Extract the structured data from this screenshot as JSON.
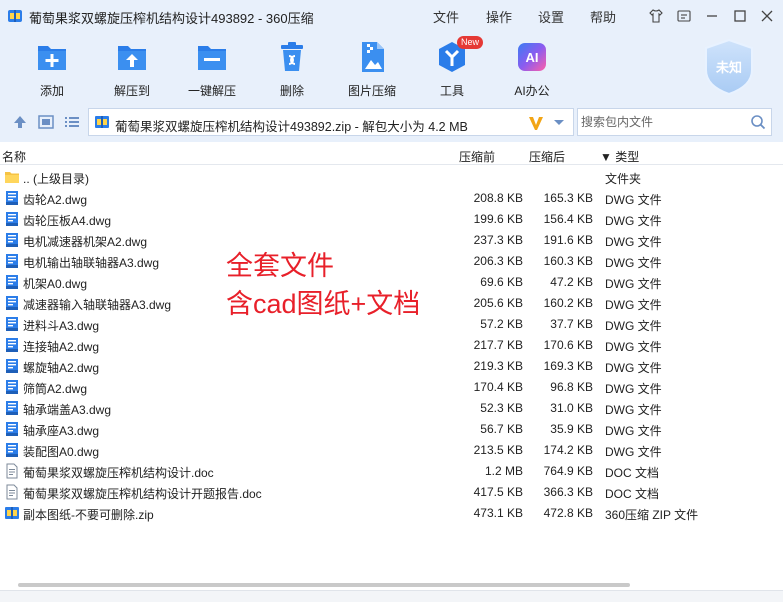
{
  "window": {
    "title": "葡萄果浆双螺旋压榨机结构设计493892 - 360压缩",
    "menu": [
      "文件",
      "操作",
      "设置",
      "帮助"
    ]
  },
  "toolbar": {
    "items": [
      {
        "label": "添加",
        "icon": "add-icon"
      },
      {
        "label": "解压到",
        "icon": "extract-to-icon"
      },
      {
        "label": "一键解压",
        "icon": "one-click-extract-icon"
      },
      {
        "label": "删除",
        "icon": "trash-icon"
      },
      {
        "label": "图片压缩",
        "icon": "image-compress-icon"
      },
      {
        "label": "工具",
        "icon": "tools-icon",
        "badge": "New"
      },
      {
        "label": "AI办公",
        "icon": "ai-office-icon",
        "icon_text": "AI"
      }
    ],
    "account_label": "未知"
  },
  "address": {
    "path": "葡萄果浆双螺旋压榨机结构设计493892.zip - 解包大小为 4.2 MB",
    "search_placeholder": "搜索包内文件"
  },
  "columns": {
    "name": "名称",
    "compressed": "压缩前",
    "original": "压缩后",
    "type": "▼ 类型"
  },
  "files": [
    {
      "name": ".. (上级目录)",
      "compressed": "",
      "original": "",
      "type": "文件夹",
      "kind": "folder"
    },
    {
      "name": "齿轮A2.dwg",
      "compressed": "208.8 KB",
      "original": "165.3 KB",
      "type": "DWG 文件",
      "kind": "dwg"
    },
    {
      "name": "齿轮压板A4.dwg",
      "compressed": "199.6 KB",
      "original": "156.4 KB",
      "type": "DWG 文件",
      "kind": "dwg"
    },
    {
      "name": "电机减速器机架A2.dwg",
      "compressed": "237.3 KB",
      "original": "191.6 KB",
      "type": "DWG 文件",
      "kind": "dwg"
    },
    {
      "name": "电机输出轴联轴器A3.dwg",
      "compressed": "206.3 KB",
      "original": "160.3 KB",
      "type": "DWG 文件",
      "kind": "dwg"
    },
    {
      "name": "机架A0.dwg",
      "compressed": "69.6 KB",
      "original": "47.2 KB",
      "type": "DWG 文件",
      "kind": "dwg"
    },
    {
      "name": "减速器输入轴联轴器A3.dwg",
      "compressed": "205.6 KB",
      "original": "160.2 KB",
      "type": "DWG 文件",
      "kind": "dwg"
    },
    {
      "name": "进料斗A3.dwg",
      "compressed": "57.2 KB",
      "original": "37.7 KB",
      "type": "DWG 文件",
      "kind": "dwg"
    },
    {
      "name": "连接轴A2.dwg",
      "compressed": "217.7 KB",
      "original": "170.6 KB",
      "type": "DWG 文件",
      "kind": "dwg"
    },
    {
      "name": "螺旋轴A2.dwg",
      "compressed": "219.3 KB",
      "original": "169.3 KB",
      "type": "DWG 文件",
      "kind": "dwg"
    },
    {
      "name": "筛筒A2.dwg",
      "compressed": "170.4 KB",
      "original": "96.8 KB",
      "type": "DWG 文件",
      "kind": "dwg"
    },
    {
      "name": "轴承端盖A3.dwg",
      "compressed": "52.3 KB",
      "original": "31.0 KB",
      "type": "DWG 文件",
      "kind": "dwg"
    },
    {
      "name": "轴承座A3.dwg",
      "compressed": "56.7 KB",
      "original": "35.9 KB",
      "type": "DWG 文件",
      "kind": "dwg"
    },
    {
      "name": "装配图A0.dwg",
      "compressed": "213.5 KB",
      "original": "174.2 KB",
      "type": "DWG 文件",
      "kind": "dwg"
    },
    {
      "name": "葡萄果浆双螺旋压榨机结构设计.doc",
      "compressed": "1.2 MB",
      "original": "764.9 KB",
      "type": "DOC 文档",
      "kind": "doc"
    },
    {
      "name": "葡萄果浆双螺旋压榨机结构设计开题报告.doc",
      "compressed": "417.5 KB",
      "original": "366.3 KB",
      "type": "DOC 文档",
      "kind": "doc"
    },
    {
      "name": "副本图纸-不要可删除.zip",
      "compressed": "473.1 KB",
      "original": "472.8 KB",
      "type": "360压缩 ZIP 文件",
      "kind": "zip"
    }
  ],
  "overlay": {
    "line1": "全套文件",
    "line2": "含cad图纸+文档"
  },
  "colors": {
    "accent": "#2b7de9",
    "overlay_text": "#e8202a",
    "chrome_bg": "#e8f0fb"
  }
}
